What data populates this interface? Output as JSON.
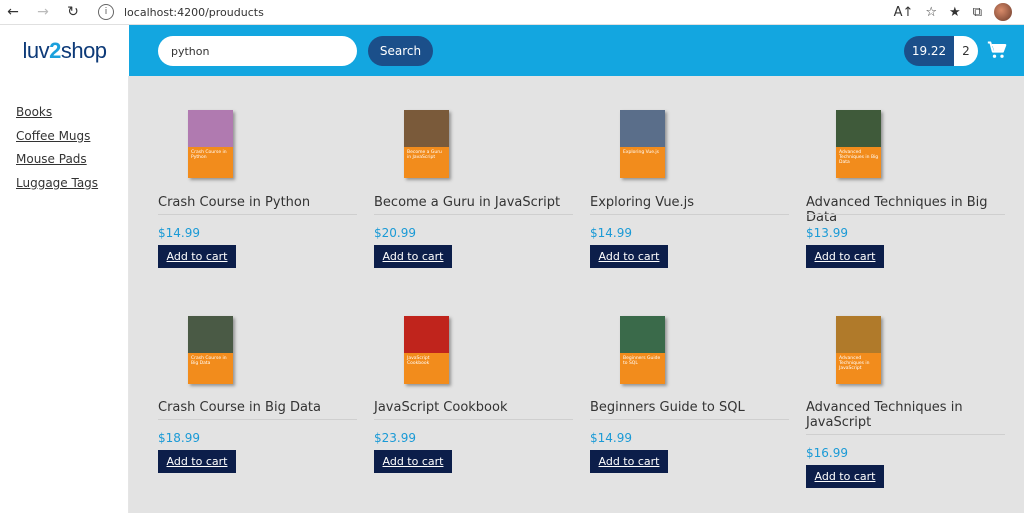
{
  "browser": {
    "url": "localhost:4200/prouducts"
  },
  "header": {
    "logo_prefix": "luv",
    "logo_two": "2",
    "logo_suffix": "shop",
    "search_value": "python",
    "search_label": "Search",
    "cart_total": "19.22",
    "cart_quantity": "2"
  },
  "sidebar": {
    "categories": [
      "Books",
      "Coffee Mugs",
      "Mouse Pads",
      "Luggage Tags"
    ]
  },
  "products": [
    {
      "name": "Crash Course in Python",
      "price": "$14.99",
      "cover_title": "Crash Course in Python",
      "cover_color": "#b07ab0",
      "button": "Add to cart"
    },
    {
      "name": "Become a Guru in JavaScript",
      "price": "$20.99",
      "cover_title": "Become a Guru in JavaScript",
      "cover_color": "#7a5a3a",
      "button": "Add to cart"
    },
    {
      "name": "Exploring Vue.js",
      "price": "$14.99",
      "cover_title": "Exploring Vue.js",
      "cover_color": "#5a6e8a",
      "button": "Add to cart"
    },
    {
      "name": "Advanced Techniques in Big Data",
      "price": "$13.99",
      "cover_title": "Advanced Techniques in Big Data",
      "cover_color": "#3f5a3a",
      "button": "Add to cart"
    },
    {
      "name": "Crash Course in Big Data",
      "price": "$18.99",
      "cover_title": "Crash Course in Big Data",
      "cover_color": "#4a5a45",
      "button": "Add to cart"
    },
    {
      "name": "JavaScript Cookbook",
      "price": "$23.99",
      "cover_title": "JavaScript Cookbook",
      "cover_color": "#c0241c",
      "button": "Add to cart"
    },
    {
      "name": "Beginners Guide to SQL",
      "price": "$14.99",
      "cover_title": "Beginners Guide to SQL",
      "cover_color": "#3a6a4a",
      "button": "Add to cart"
    },
    {
      "name": "Advanced Techniques in JavaScript",
      "price": "$16.99",
      "cover_title": "Advanced Techniques in JavaScript",
      "cover_color": "#b07a2a",
      "button": "Add to cart"
    }
  ],
  "colors": {
    "topbar": "#13a6e0",
    "search_button": "#1b4f8a",
    "add_button": "#0c1e4a",
    "price": "#1a9ad6",
    "book_cover": "#f28c1c"
  }
}
